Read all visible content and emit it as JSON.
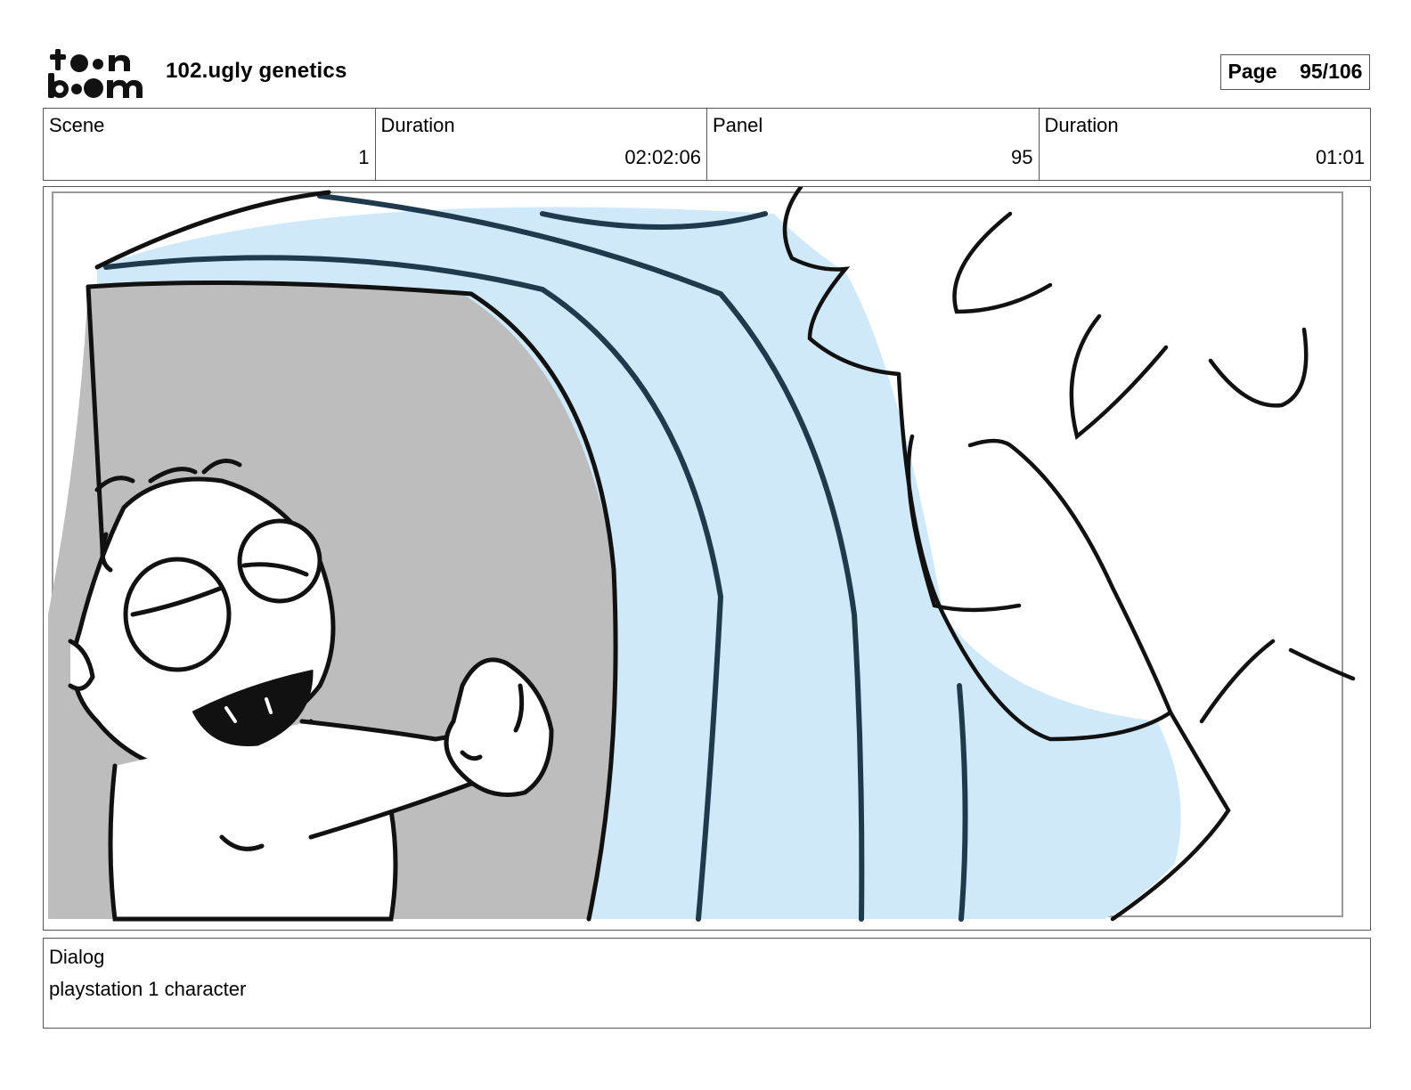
{
  "header": {
    "logo_top": "t●●n",
    "logo_bottom": "b●●m",
    "project_title": "102.ugly genetics",
    "page_label": "Page",
    "page_value": "95/106"
  },
  "info": {
    "scene_label": "Scene",
    "scene_value": "1",
    "scene_duration_label": "Duration",
    "scene_duration_value": "02:02:06",
    "panel_label": "Panel",
    "panel_value": "95",
    "panel_duration_label": "Duration",
    "panel_duration_value": "01:01"
  },
  "dialog": {
    "label": "Dialog",
    "text": "playstation 1 character"
  },
  "colors": {
    "border": "#555555",
    "sky_blue": "#cfe9fb",
    "wave_line": "#1f3a4d",
    "cave_gray": "#bdbdbd",
    "ink": "#111111"
  }
}
